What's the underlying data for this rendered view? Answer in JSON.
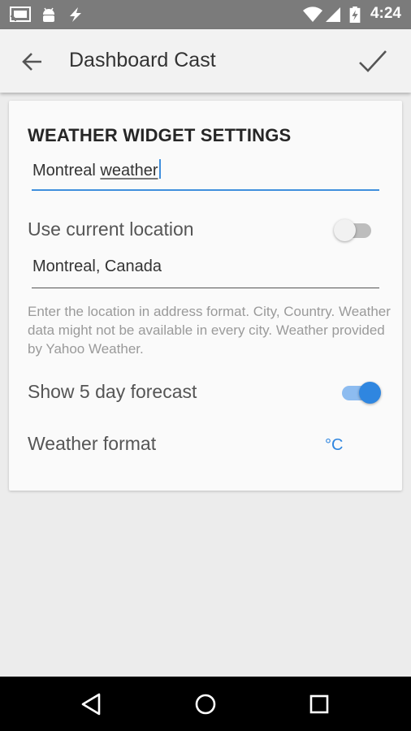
{
  "status_bar": {
    "time": "4:24",
    "icons": [
      "cast-icon",
      "android-debug-icon",
      "lightning-icon",
      "wifi-icon",
      "signal-icon",
      "battery-charging-icon"
    ]
  },
  "app_bar": {
    "title": "Dashboard Cast",
    "back_icon": "back-arrow-icon",
    "confirm_icon": "checkmark-icon"
  },
  "card": {
    "title": "WEATHER WIDGET SETTINGS",
    "title_input": {
      "value_part1": "Montreal ",
      "value_part2": "weather"
    },
    "use_current_location": {
      "label": "Use current location",
      "checked": false
    },
    "location_input": {
      "value": "Montreal, Canada"
    },
    "hint": "Enter the location in address format. City, Country. Weather data might not be available in every city. Weather provided by Yahoo Weather.",
    "show_forecast": {
      "label": "Show 5 day forecast",
      "checked": true
    },
    "weather_format": {
      "label": "Weather format",
      "value": "°C"
    }
  },
  "nav_bar": {
    "icons": [
      "nav-back-icon",
      "nav-home-icon",
      "nav-recents-icon"
    ]
  },
  "colors": {
    "accent": "#2f86e0",
    "status_bar": "#7b7b7b",
    "app_bar": "#f2f2f2",
    "background": "#ececec"
  }
}
